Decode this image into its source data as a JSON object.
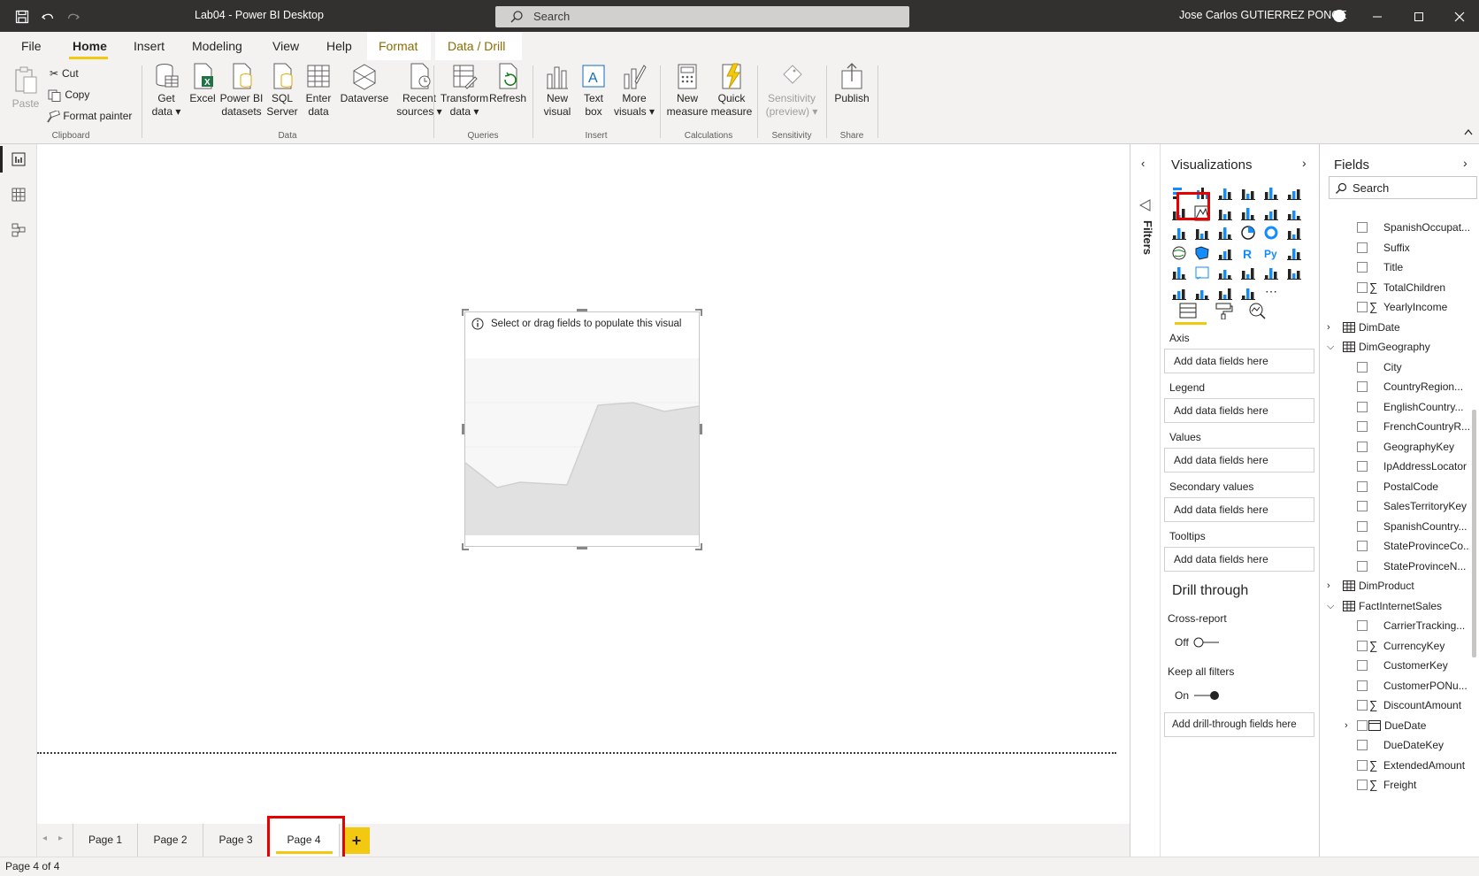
{
  "titlebar": {
    "title": "Lab04 - Power BI Desktop",
    "search_placeholder": "Search",
    "user": "Jose Carlos GUTIERREZ PONCE"
  },
  "menu": [
    "File",
    "Home",
    "Insert",
    "Modeling",
    "View",
    "Help",
    "Format",
    "Data / Drill"
  ],
  "ribbon": {
    "clipboard": {
      "paste": "Paste",
      "cut": "Cut",
      "copy": "Copy",
      "format_painter": "Format painter",
      "label": "Clipboard"
    },
    "data": {
      "get_data": [
        "Get",
        "data"
      ],
      "excel": "Excel",
      "pbi": [
        "Power BI",
        "datasets"
      ],
      "sql": [
        "SQL",
        "Server"
      ],
      "enter": [
        "Enter",
        "data"
      ],
      "dataverse": "Dataverse",
      "recent": [
        "Recent",
        "sources"
      ],
      "label": "Data"
    },
    "queries": {
      "transform": [
        "Transform",
        "data"
      ],
      "refresh": "Refresh",
      "label": "Queries"
    },
    "insert": {
      "newvisual": [
        "New",
        "visual"
      ],
      "textbox": [
        "Text",
        "box"
      ],
      "more": [
        "More",
        "visuals"
      ],
      "label": "Insert"
    },
    "calculations": {
      "newmeasure": [
        "New",
        "measure"
      ],
      "quick": [
        "Quick",
        "measure"
      ],
      "label": "Calculations"
    },
    "sensitivity": {
      "btn": [
        "Sensitivity",
        "(preview)"
      ],
      "label": "Sensitivity"
    },
    "share": {
      "publish": "Publish",
      "label": "Share"
    }
  },
  "canvas": {
    "visual_hint": "Select or drag fields to populate this visual"
  },
  "pages": [
    "Page 1",
    "Page 2",
    "Page 3",
    "Page 4"
  ],
  "active_page": "Page 4",
  "status": "Page 4 of 4",
  "filters_label": "Filters",
  "visualizations": {
    "title": "Visualizations",
    "wells": [
      {
        "label": "Axis",
        "placeholder": "Add data fields here"
      },
      {
        "label": "Legend",
        "placeholder": "Add data fields here"
      },
      {
        "label": "Values",
        "placeholder": "Add data fields here"
      },
      {
        "label": "Secondary values",
        "placeholder": "Add data fields here"
      },
      {
        "label": "Tooltips",
        "placeholder": "Add data fields here"
      }
    ],
    "drill": {
      "title": "Drill through",
      "cross_report": "Cross-report",
      "cross_state": "Off",
      "keep_filters": "Keep all filters",
      "keep_state": "On",
      "drill_well": "Add drill-through fields here"
    }
  },
  "fields": {
    "title": "Fields",
    "search_placeholder": "Search",
    "rows": [
      {
        "type": "field",
        "name": "SpanishOccupat...",
        "sigma": false
      },
      {
        "type": "field",
        "name": "Suffix",
        "sigma": false
      },
      {
        "type": "field",
        "name": "Title",
        "sigma": false
      },
      {
        "type": "field",
        "name": "TotalChildren",
        "sigma": true
      },
      {
        "type": "field",
        "name": "YearlyIncome",
        "sigma": true
      },
      {
        "type": "table",
        "name": "DimDate",
        "expanded": false
      },
      {
        "type": "table",
        "name": "DimGeography",
        "expanded": true
      },
      {
        "type": "field",
        "name": "City",
        "sigma": false
      },
      {
        "type": "field",
        "name": "CountryRegion...",
        "sigma": false
      },
      {
        "type": "field",
        "name": "EnglishCountry...",
        "sigma": false
      },
      {
        "type": "field",
        "name": "FrenchCountryR...",
        "sigma": false
      },
      {
        "type": "field",
        "name": "GeographyKey",
        "sigma": false
      },
      {
        "type": "field",
        "name": "IpAddressLocator",
        "sigma": false
      },
      {
        "type": "field",
        "name": "PostalCode",
        "sigma": false
      },
      {
        "type": "field",
        "name": "SalesTerritoryKey",
        "sigma": false
      },
      {
        "type": "field",
        "name": "SpanishCountry...",
        "sigma": false
      },
      {
        "type": "field",
        "name": "StateProvinceCo...",
        "sigma": false
      },
      {
        "type": "field",
        "name": "StateProvinceN...",
        "sigma": false
      },
      {
        "type": "table",
        "name": "DimProduct",
        "expanded": false
      },
      {
        "type": "table",
        "name": "FactInternetSales",
        "expanded": true
      },
      {
        "type": "field",
        "name": "CarrierTracking...",
        "sigma": false
      },
      {
        "type": "field",
        "name": "CurrencyKey",
        "sigma": true
      },
      {
        "type": "field",
        "name": "CustomerKey",
        "sigma": false
      },
      {
        "type": "field",
        "name": "CustomerPONu...",
        "sigma": false
      },
      {
        "type": "field",
        "name": "DiscountAmount",
        "sigma": true
      },
      {
        "type": "hier",
        "name": "DueDate",
        "sigma": false
      },
      {
        "type": "field",
        "name": "DueDateKey",
        "sigma": false
      },
      {
        "type": "field",
        "name": "ExtendedAmount",
        "sigma": true
      },
      {
        "type": "field",
        "name": "Freight",
        "sigma": true
      }
    ]
  },
  "colors": {
    "accent": "#f2c811",
    "highlight": "#e60000",
    "titlebar": "#323130",
    "ribbon": "#f3f2f1"
  }
}
